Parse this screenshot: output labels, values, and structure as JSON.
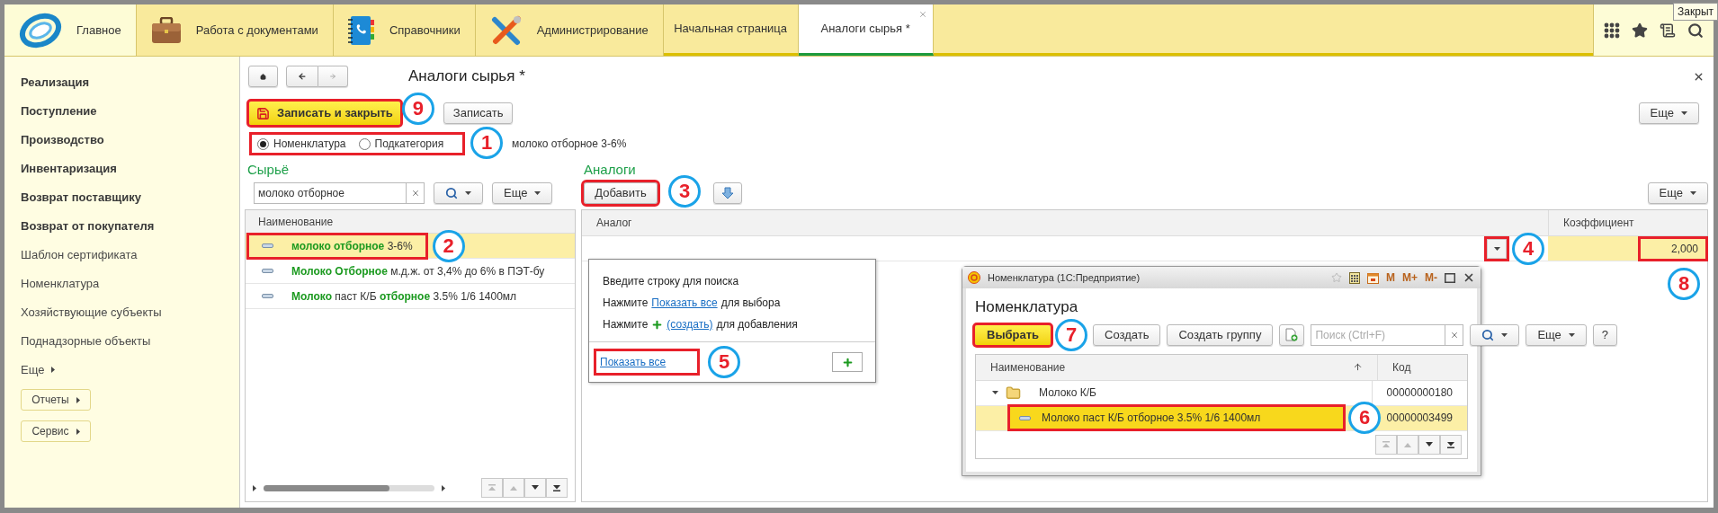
{
  "top_bar": {
    "sections": [
      {
        "label": "Главное",
        "selected": true
      },
      {
        "label": "Работа с документами",
        "selected": false
      },
      {
        "label": "Справочники",
        "selected": false
      },
      {
        "label": "Администрирование",
        "selected": false
      }
    ],
    "open_tabs": [
      {
        "label": "Начальная страница",
        "selected": false
      },
      {
        "label": "Аналоги сырья *",
        "selected": true
      }
    ],
    "tooltip": "Закрыт"
  },
  "sidebar": {
    "items": [
      {
        "label": "Реализация",
        "kind": "section"
      },
      {
        "label": "Поступление",
        "kind": "section"
      },
      {
        "label": "Производство",
        "kind": "section"
      },
      {
        "label": "Инвентаризация",
        "kind": "section"
      },
      {
        "label": "Возврат поставщику",
        "kind": "section"
      },
      {
        "label": "Возврат от покупателя",
        "kind": "section"
      },
      {
        "label": "Шаблон сертификата",
        "kind": "link"
      },
      {
        "label": "Номенклатура",
        "kind": "link"
      },
      {
        "label": "Хозяйствующие субъекты",
        "kind": "link"
      },
      {
        "label": "Поднадзорные объекты",
        "kind": "link"
      }
    ],
    "more": "Еще",
    "buttons": [
      "Отчеты",
      "Сервис"
    ]
  },
  "form": {
    "title": "Аналоги сырья *",
    "toolbar": {
      "save_close": {
        "label": "Записать и закрыть",
        "highlighted": true,
        "callout": "9"
      },
      "save": "Записать",
      "more": "Еще"
    },
    "type_choice": {
      "options": [
        {
          "label": "Номенклатура",
          "selected": true
        },
        {
          "label": "Подкатегория",
          "selected": false
        }
      ],
      "highlighted": true,
      "callout": "1"
    },
    "selected_name": "молоко отборное 3-6%",
    "raw": {
      "heading": "Сырьё",
      "search": {
        "value": "молоко отборное"
      },
      "more": "Еще",
      "table": {
        "columns": [
          "Наименование"
        ],
        "rows": [
          {
            "name": "**молоко отборное** 3-6%",
            "selected": true,
            "highlighted": true,
            "callout": "2"
          },
          {
            "name": "**Молоко Отборное** м.д.ж. от 3,4% до 6%  в ПЭТ-бу",
            "selected": false,
            "highlighted": false
          },
          {
            "name": "**Молоко** паст К/Б **отборное** 3.5% 1/6 1400мл",
            "selected": false,
            "highlighted": false
          }
        ]
      }
    },
    "analogs": {
      "heading": "Аналоги",
      "add": {
        "label": "Добавить",
        "highlighted": true,
        "callout": "3"
      },
      "more": "Еще",
      "table": {
        "columns": [
          "Аналог",
          "Коэффициент"
        ],
        "rows": [
          {
            "dropdown": {
              "highlighted": true,
              "callout": "4"
            },
            "coefficient": {
              "value": "2,000",
              "highlighted": true,
              "callout": "8"
            }
          }
        ]
      }
    },
    "popup": {
      "hint": "Введите строку для поиска",
      "lines": [
        {
          "before": "Нажмите",
          "link": "Показать все",
          "after": "для выбора",
          "kind": "plain"
        },
        {
          "before": "Нажмите",
          "link": "(создать)",
          "after": "для добавления",
          "kind": "plus"
        }
      ],
      "show_all": {
        "label": "Показать все",
        "highlighted": true,
        "callout": "5"
      }
    },
    "picker": {
      "title": "Номенклатура (1С:Предприятие)",
      "memory_buttons": [
        "M",
        "M+",
        "M-"
      ],
      "heading": "Номенклатура",
      "toolbar": {
        "choose": {
          "label": "Выбрать",
          "highlighted": true,
          "callout": "7"
        },
        "create": "Создать",
        "create_group": "Создать группу",
        "search": {
          "placeholder": "Поиск (Ctrl+F)"
        },
        "more": "Еще",
        "help": "?"
      },
      "table": {
        "columns": [
          "Наименование",
          "Код"
        ],
        "rows": [
          {
            "name": "Молоко К/Б",
            "code": "00000000180",
            "kind": "group",
            "expanded": true,
            "selected": false,
            "children": [
              {
                "name": "Молоко паст К/Б отборное 3.5% 1/6 1400мл",
                "code": "00000003499",
                "kind": "item",
                "selected": true,
                "highlighted": true,
                "callout": "6"
              }
            ]
          }
        ]
      }
    }
  }
}
